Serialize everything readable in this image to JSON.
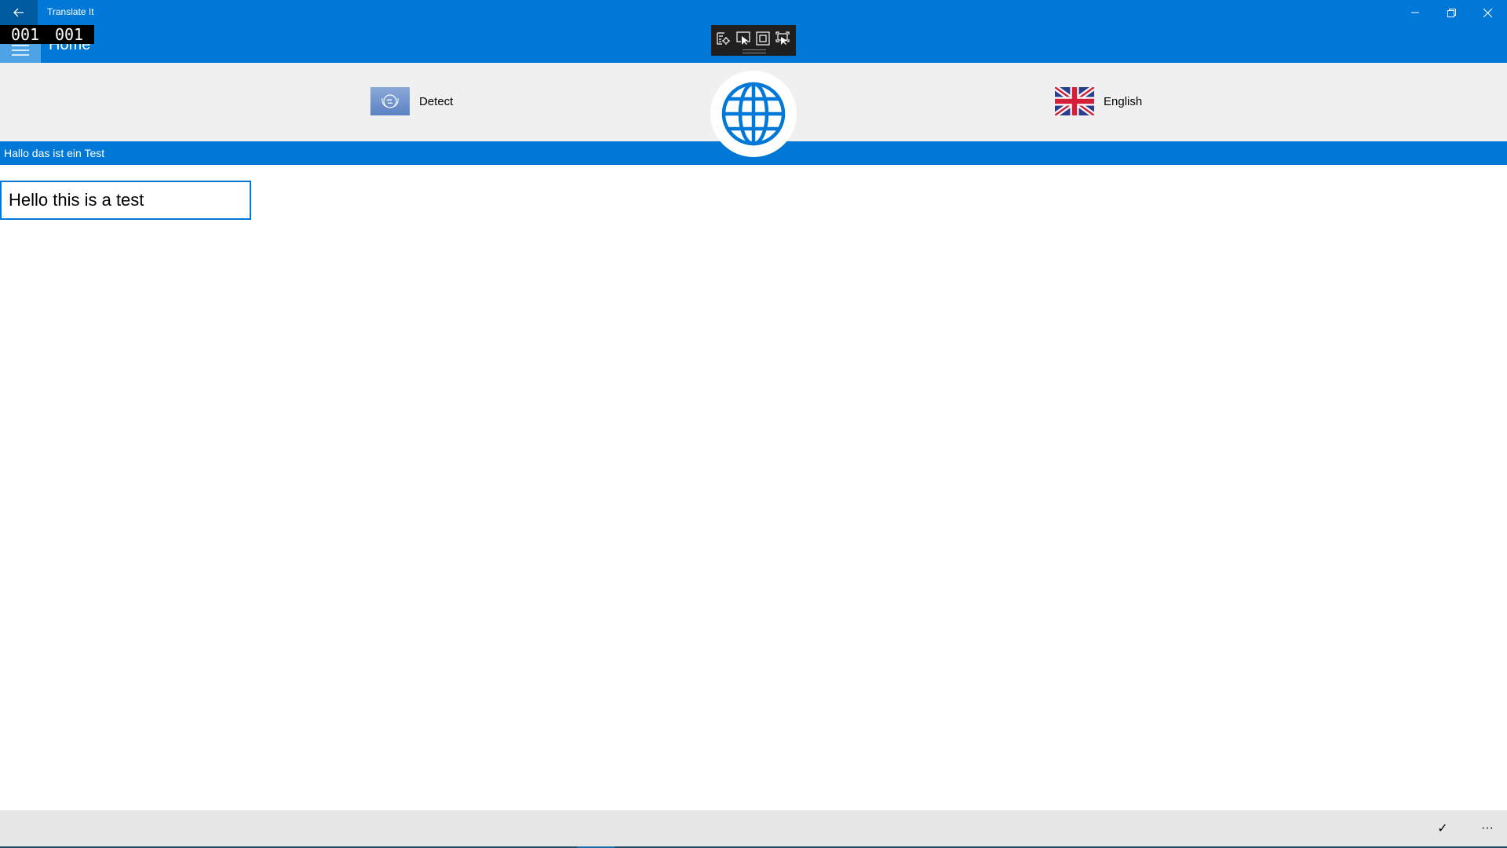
{
  "window": {
    "title": "Translate It",
    "back_icon": "arrow-left-icon",
    "controls": {
      "minimize": "minimize-icon",
      "restore": "restore-icon",
      "close": "close-icon"
    }
  },
  "nav": {
    "menu_icon": "hamburger-icon",
    "page_label": "Home"
  },
  "overlay": {
    "counter_left": "001",
    "counter_right": "001"
  },
  "debug_toolbar": {
    "buttons": [
      "live-visual-tree-icon",
      "select-element-icon",
      "display-layout-adorners-icon",
      "track-focused-element-icon"
    ]
  },
  "languages": {
    "source": {
      "label": "Detect",
      "flag": "un-flag-icon"
    },
    "target": {
      "label": "English",
      "flag": "uk-flag-icon"
    },
    "swap_icon": "globe-icon"
  },
  "source_text": "Hallo das ist ein Test",
  "translation": {
    "value": "Hello this is a test"
  },
  "command_bar": {
    "accept_glyph": "✓",
    "more_glyph": "···"
  },
  "colors": {
    "accent": "#0078d7",
    "accent_dark": "#005a9e",
    "lang_bar_bg": "#f0f0f0",
    "command_bar_bg": "#e6e6e6"
  }
}
